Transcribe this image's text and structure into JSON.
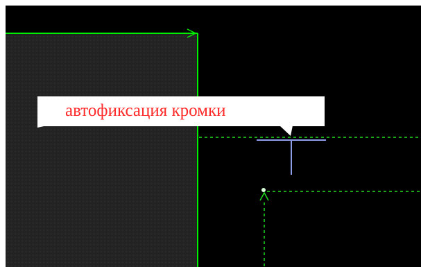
{
  "viewport": {
    "background": "#000000",
    "frame_color": "#ffffff"
  },
  "tooltip": {
    "text": "автофиксация кромки",
    "background": "#ffffff",
    "text_color": "#ff2a2a"
  },
  "objects": {
    "panel_fill": "#242424",
    "edge_color": "#00ee00",
    "guide_color": "#22dd22",
    "cursor_color": "#8f9de8",
    "marker_color": "#d8ffd8"
  },
  "icons": [
    "edge-arrow-icon",
    "crosshair-cursor-icon",
    "snap-point-icon"
  ]
}
